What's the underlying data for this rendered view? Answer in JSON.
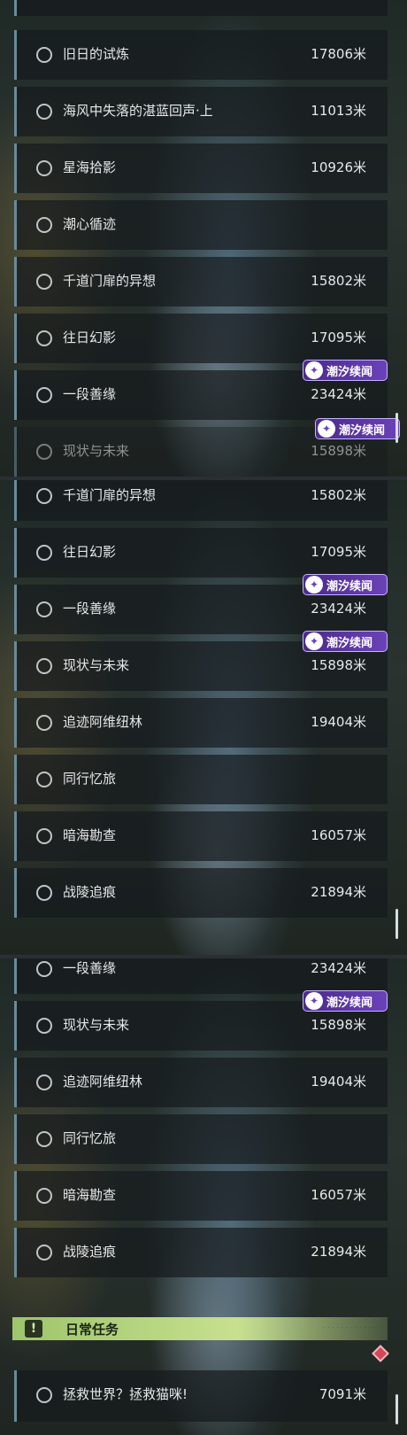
{
  "badge_label": "潮汐续闻",
  "panel1": {
    "rows": [
      {
        "name": "旧日的试炼",
        "dist": "17806米"
      },
      {
        "name": "海风中失落的湛蓝回声·上",
        "dist": "11013米"
      },
      {
        "name": "星海拾影",
        "dist": "10926米"
      },
      {
        "name": "潮心循迹",
        "dist": ""
      },
      {
        "name": "千道门扉的异想",
        "dist": "15802米"
      },
      {
        "name": "往日幻影",
        "dist": "17095米"
      },
      {
        "name": "一段善缘",
        "dist": "23424米"
      },
      {
        "name": "现状与未来",
        "dist": "15898米"
      }
    ]
  },
  "panel2": {
    "rows": [
      {
        "name": "千道门扉的异想",
        "dist": "15802米"
      },
      {
        "name": "往日幻影",
        "dist": "17095米"
      },
      {
        "name": "一段善缘",
        "dist": "23424米"
      },
      {
        "name": "现状与未来",
        "dist": "15898米"
      },
      {
        "name": "追迹阿维纽林",
        "dist": "19404米"
      },
      {
        "name": "同行忆旅",
        "dist": ""
      },
      {
        "name": "暗海勘查",
        "dist": "16057米"
      },
      {
        "name": "战陵追痕",
        "dist": "21894米"
      }
    ]
  },
  "panel3": {
    "rows": [
      {
        "name": "一段善缘",
        "dist": "23424米"
      },
      {
        "name": "现状与未来",
        "dist": "15898米"
      },
      {
        "name": "追迹阿维纽林",
        "dist": "19404米"
      },
      {
        "name": "同行忆旅",
        "dist": ""
      },
      {
        "name": "暗海勘查",
        "dist": "16057米"
      },
      {
        "name": "战陵追痕",
        "dist": "21894米"
      }
    ],
    "daily_section": {
      "icon": "!",
      "title": "日常任务",
      "row": {
        "name": "拯救世界？拯救猫咪!",
        "dist": "7091米"
      }
    }
  }
}
